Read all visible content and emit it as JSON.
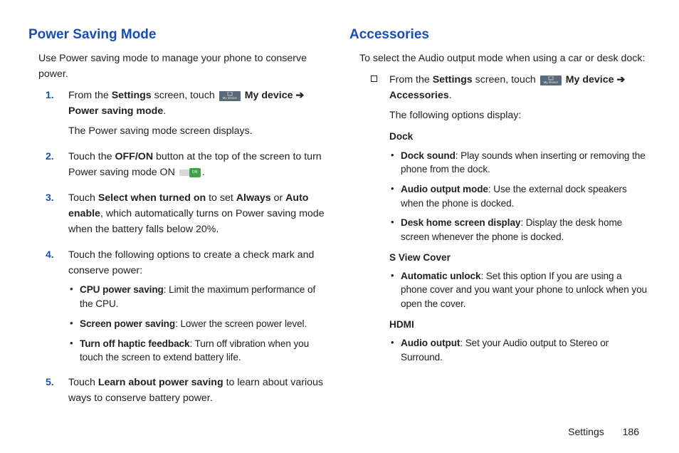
{
  "left": {
    "heading": "Power Saving Mode",
    "intro": "Use Power saving mode to manage your phone to conserve power.",
    "steps": [
      {
        "num": "1.",
        "pre": "From the ",
        "b1": "Settings",
        "mid": " screen, touch ",
        "b2": " My device ",
        "arrow": "➔",
        "line2b": "Power saving mode",
        "line2post": ".",
        "sub": "The Power saving mode screen displays."
      },
      {
        "num": "2.",
        "pre": "Touch the ",
        "b1": "OFF/ON",
        "mid": " button at the top of the screen to turn Power saving mode ON ",
        "post": "."
      },
      {
        "num": "3.",
        "pre": "Touch ",
        "b1": "Select when turned on",
        "mid": " to set ",
        "b2": "Always",
        "mid2": " or ",
        "b3": "Auto enable",
        "post": ", which automatically turns on Power saving mode when the battery falls below 20%."
      },
      {
        "num": "4.",
        "text": "Touch the following options to create a check mark and conserve power:",
        "bullets": [
          {
            "b": "CPU power saving",
            "t": ": Limit the maximum performance of the CPU."
          },
          {
            "b": "Screen power saving",
            "t": ": Lower the screen power level."
          },
          {
            "b": "Turn off haptic feedback",
            "t": ": Turn off vibration when you touch the screen to extend battery life."
          }
        ]
      },
      {
        "num": "5.",
        "pre": "Touch ",
        "b1": "Learn about power saving",
        "post": " to learn about various ways to conserve battery power."
      }
    ]
  },
  "right": {
    "heading": "Accessories",
    "intro": "To select the Audio output mode when using a car or desk dock:",
    "item": {
      "pre": "From the ",
      "b1": "Settings",
      "mid": " screen, touch ",
      "b2": " My device ",
      "arrow": "➔",
      "line2b": "Accessories",
      "line2post": ".",
      "sub": "The following options display:"
    },
    "groups": [
      {
        "title": "Dock",
        "bullets": [
          {
            "b": "Dock sound",
            "t": ": Play sounds when inserting or removing the phone from the dock."
          },
          {
            "b": "Audio output mode",
            "t": ": Use the external dock speakers when the phone is docked."
          },
          {
            "b": "Desk home screen display",
            "t": ": Display the desk home screen whenever the phone is docked."
          }
        ]
      },
      {
        "title": "S View Cover",
        "bullets": [
          {
            "b": "Automatic unlock",
            "t": ": Set this option If you are using a phone cover and you want your phone to unlock when you open the cover."
          }
        ]
      },
      {
        "title": "HDMI",
        "bullets": [
          {
            "b": "Audio output",
            "t": ": Set your Audio output to Stereo or Surround."
          }
        ]
      }
    ]
  },
  "footer": {
    "section": "Settings",
    "page": "186"
  }
}
